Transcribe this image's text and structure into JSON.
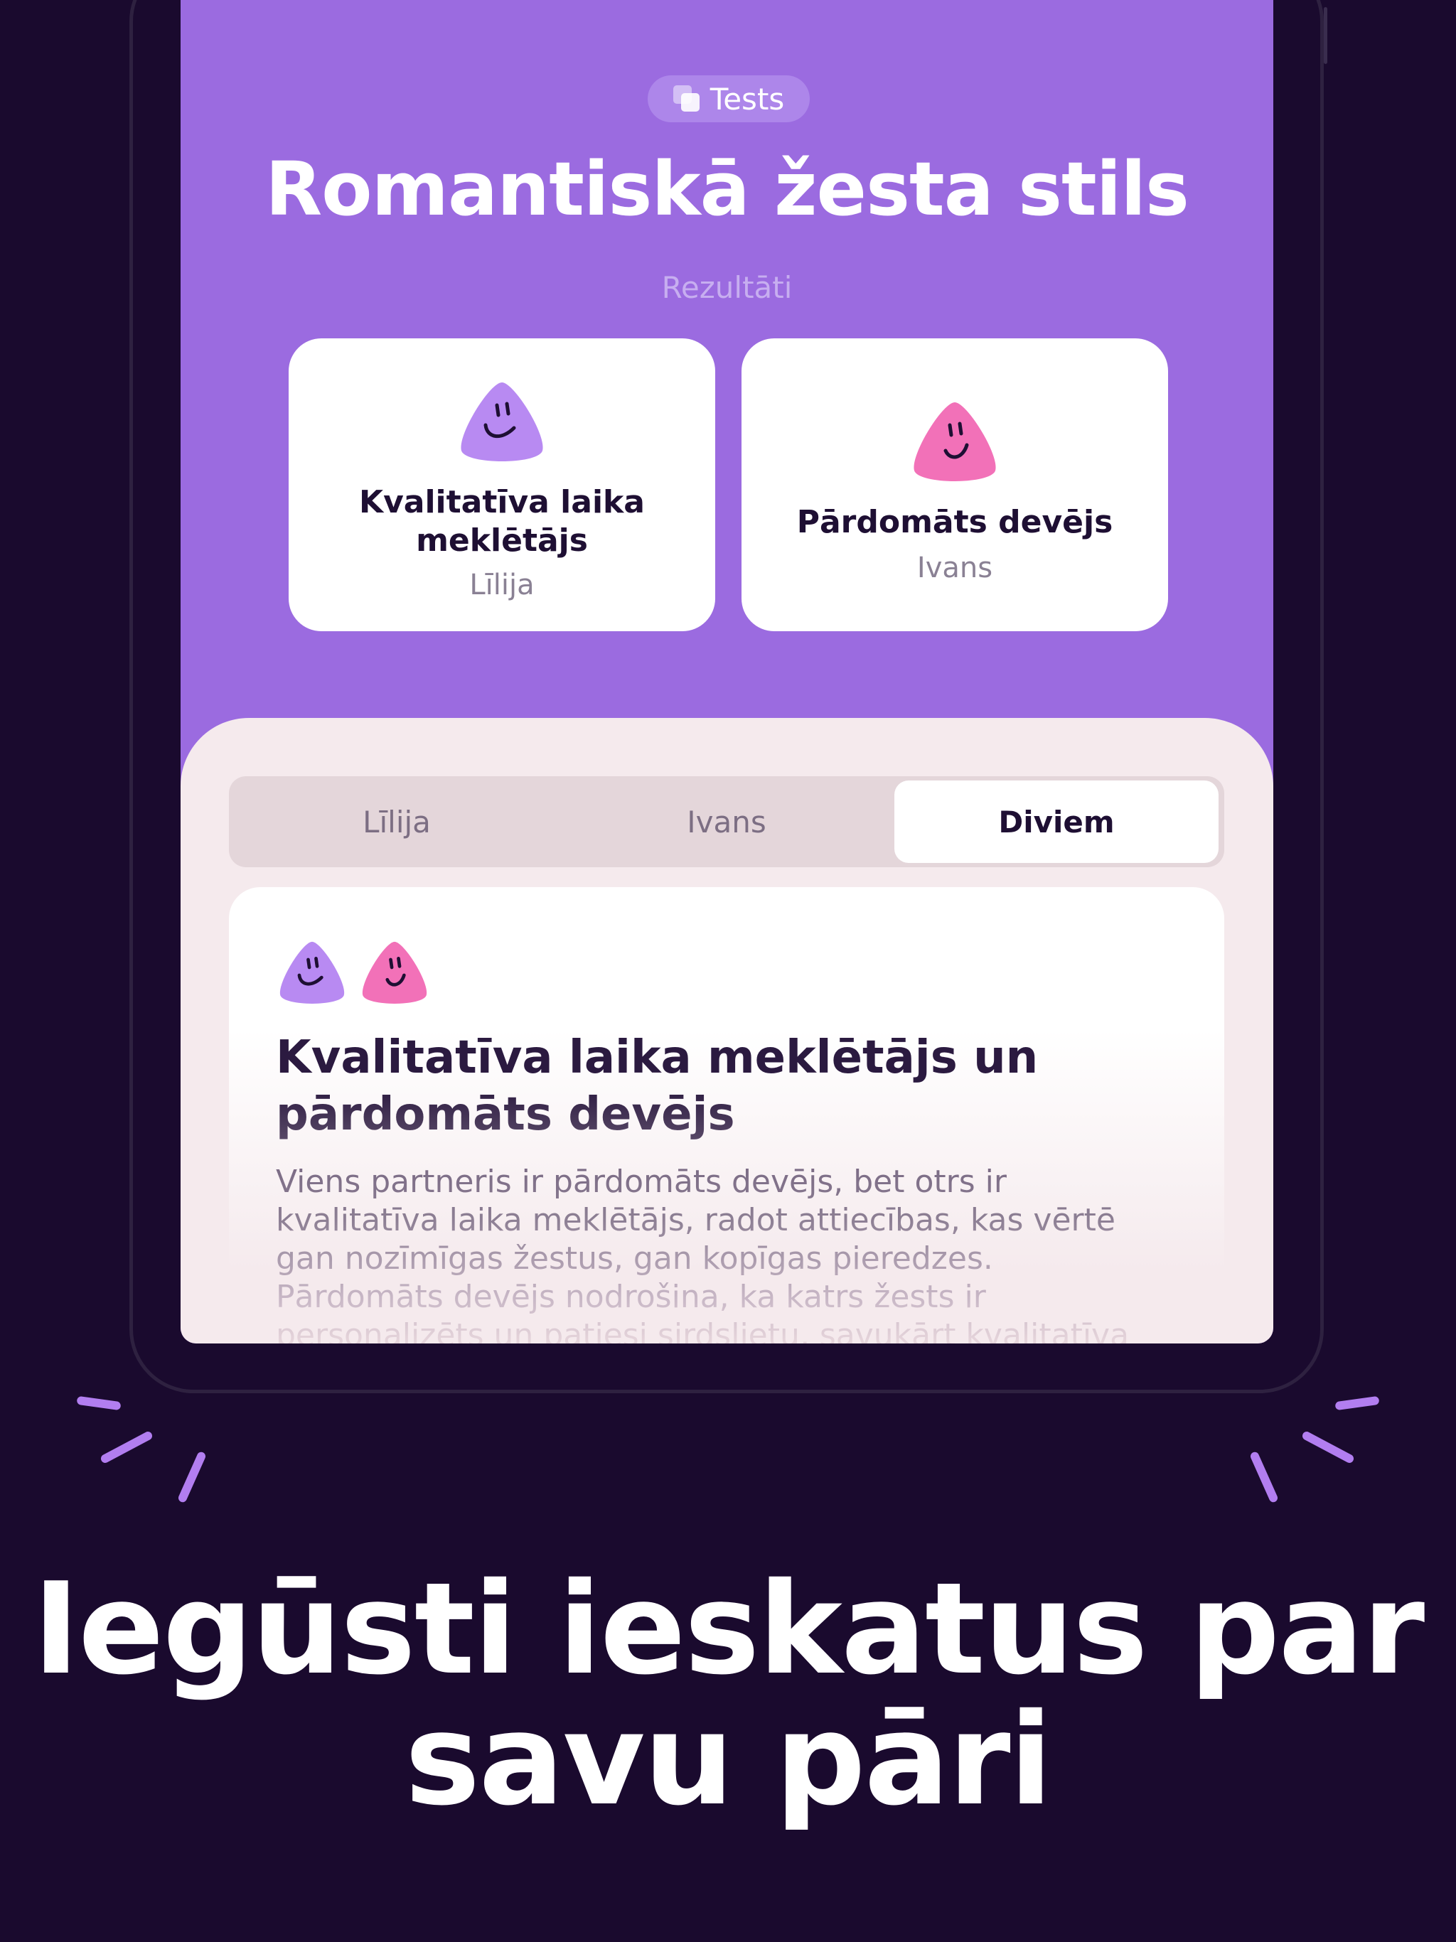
{
  "badge": {
    "label": "Tests",
    "icon": "stack-icon"
  },
  "title": "Romantiskā žesta stils",
  "subtitle": "Rezultāti",
  "results": [
    {
      "name": "Kvalitatīva laika meklētājs",
      "person": "Līlija",
      "color": "#b88af2"
    },
    {
      "name": "Pārdomāts devējs",
      "person": "Ivans",
      "color": "#f271b8"
    }
  ],
  "tabs": [
    {
      "label": "Līlija",
      "selected": false
    },
    {
      "label": "Ivans",
      "selected": false
    },
    {
      "label": "Diviem",
      "selected": true
    }
  ],
  "detail": {
    "title": "Kvalitatīva laika meklētājs un pārdomāts devējs",
    "body": "Viens partneris ir pārdomāts devējs, bet otrs ir kvalitatīva laika meklētājs, radot attiecības, kas vērtē gan nozīmīgas žestus, gan kopīgas pieredzes. Pārdomāts devējs nodrošina, ka katrs žests ir personalizēts un patiesi sirdslietu, savukārt kvalitatīva"
  },
  "headline": "Iegūsti ieskatus par savu pāri",
  "colors": {
    "background": "#1a0a2e",
    "accent": "#9b6be0",
    "sheet": "#f5eaed"
  }
}
